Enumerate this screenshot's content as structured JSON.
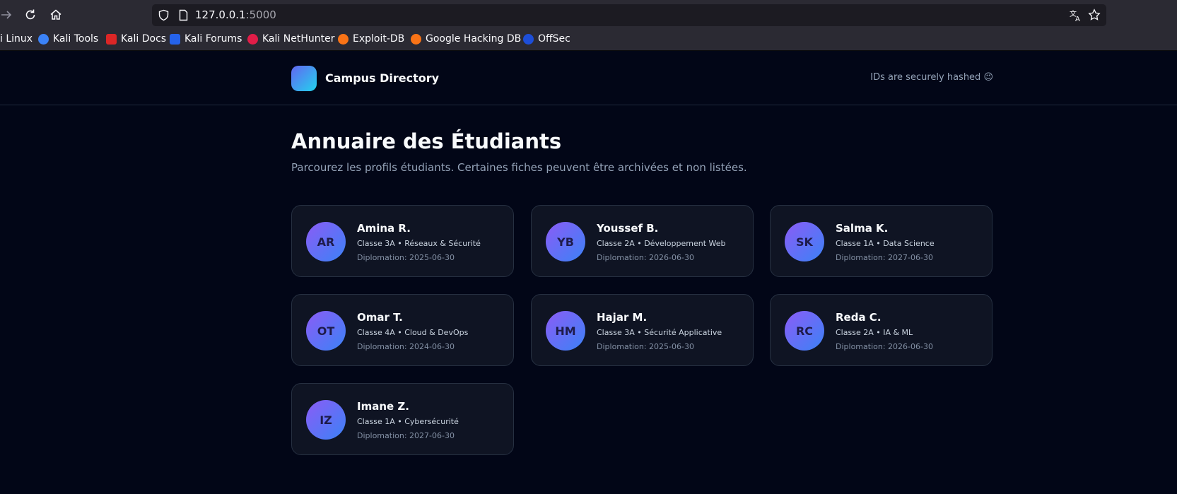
{
  "browser": {
    "url_host": "127.0.0.1",
    "url_port": ":5000",
    "bookmarks": [
      {
        "label": "i Linux",
        "color": "#2b2a33"
      },
      {
        "label": "Kali Tools",
        "color": "#3b82f6"
      },
      {
        "label": "Kali Docs",
        "color": "#dc2626"
      },
      {
        "label": "Kali Forums",
        "color": "#2563eb"
      },
      {
        "label": "Kali NetHunter",
        "color": "#e11d48"
      },
      {
        "label": "Exploit-DB",
        "color": "#f97316"
      },
      {
        "label": "Google Hacking DB",
        "color": "#f97316"
      },
      {
        "label": "OffSec",
        "color": "#1d4ed8"
      }
    ]
  },
  "header": {
    "brand": "Campus Directory",
    "note": "IDs are securely hashed 😉"
  },
  "main": {
    "title": "Annuaire des Étudiants",
    "subtitle": "Parcourez les profils étudiants. Certaines fiches peuvent être archivées et non listées."
  },
  "students": [
    {
      "initials": "AR",
      "name": "Amina R.",
      "class": "Classe 3A • Réseaux & Sécurité",
      "graduation": "Diplomation: 2025-06-30"
    },
    {
      "initials": "YB",
      "name": "Youssef B.",
      "class": "Classe 2A • Développement Web",
      "graduation": "Diplomation: 2026-06-30"
    },
    {
      "initials": "SK",
      "name": "Salma K.",
      "class": "Classe 1A • Data Science",
      "graduation": "Diplomation: 2027-06-30"
    },
    {
      "initials": "OT",
      "name": "Omar T.",
      "class": "Classe 4A • Cloud & DevOps",
      "graduation": "Diplomation: 2024-06-30"
    },
    {
      "initials": "HM",
      "name": "Hajar M.",
      "class": "Classe 3A • Sécurité Applicative",
      "graduation": "Diplomation: 2025-06-30"
    },
    {
      "initials": "RC",
      "name": "Reda C.",
      "class": "Classe 2A • IA & ML",
      "graduation": "Diplomation: 2026-06-30"
    },
    {
      "initials": "IZ",
      "name": "Imane Z.",
      "class": "Classe 1A • Cybersécurité",
      "graduation": "Diplomation: 2027-06-30"
    }
  ]
}
